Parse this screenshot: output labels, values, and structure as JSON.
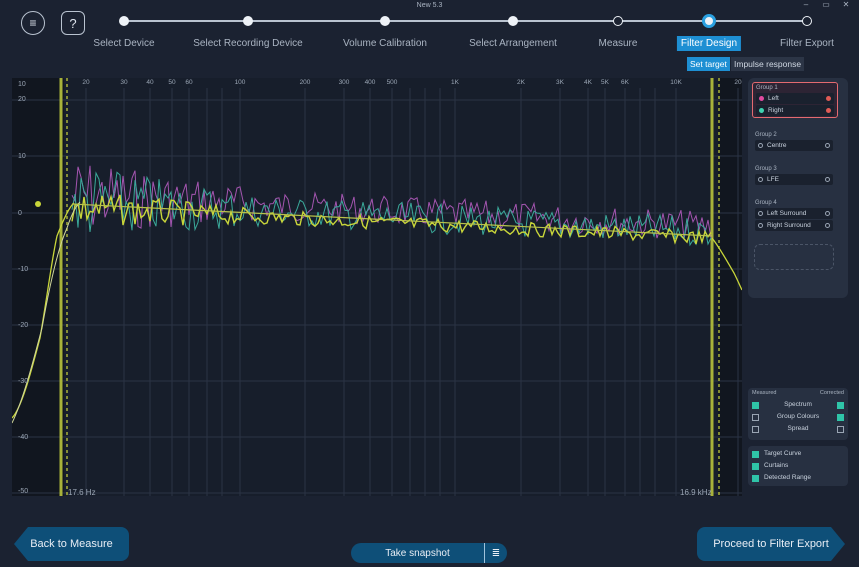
{
  "window": {
    "title": "New 5.3",
    "minimize": "–",
    "restore": "▭",
    "close": "✕"
  },
  "header": {
    "menu_icon": "≡",
    "help_icon": "?"
  },
  "steps": [
    {
      "label": "Select Device",
      "state": "done"
    },
    {
      "label": "Select Recording Device",
      "state": "done"
    },
    {
      "label": "Volume Calibration",
      "state": "done"
    },
    {
      "label": "Select Arrangement",
      "state": "done"
    },
    {
      "label": "Measure",
      "state": "open"
    },
    {
      "label": "Filter Design",
      "state": "active"
    },
    {
      "label": "Filter Export",
      "state": "open"
    }
  ],
  "subtabs": {
    "set_target": "Set target",
    "impulse_response": "Impulse response"
  },
  "graph": {
    "y_ticks": [
      "10",
      "20",
      "10",
      "0",
      "-10",
      "-20",
      "-30",
      "-40",
      "-50"
    ],
    "x_ticks": [
      "20",
      "30",
      "40",
      "50",
      "60",
      "100",
      "200",
      "300",
      "400",
      "500",
      "1K",
      "2K",
      "3K",
      "4K",
      "5K",
      "6K",
      "10K",
      "20"
    ],
    "low_edge": "17.6 Hz",
    "high_edge": "16.9 kHz",
    "colors": {
      "target": "#c9d63a",
      "left": "#a455b0",
      "right": "#3aa99a"
    }
  },
  "groups": [
    {
      "title": "Group 1",
      "channels": [
        {
          "name": "Left",
          "color": "#e04aa0"
        },
        {
          "name": "Right",
          "color": "#3fd3b0"
        }
      ]
    },
    {
      "title": "Group 2",
      "channels": [
        {
          "name": "Centre"
        }
      ]
    },
    {
      "title": "Group 3",
      "channels": [
        {
          "name": "LFE"
        }
      ]
    },
    {
      "title": "Group 4",
      "channels": [
        {
          "name": "Left Surround"
        },
        {
          "name": "Right Surround"
        }
      ]
    }
  ],
  "display_options": {
    "measured": "Measured",
    "corrected": "Corrected",
    "rows": [
      {
        "label": "Spectrum",
        "measured": true,
        "corrected": true
      },
      {
        "label": "Group Colours",
        "measured": false,
        "corrected": true
      },
      {
        "label": "Spread",
        "measured": false,
        "corrected": false
      }
    ]
  },
  "overlay_options": [
    {
      "label": "Target Curve",
      "checked": true
    },
    {
      "label": "Curtains",
      "checked": true
    },
    {
      "label": "Detected Range",
      "checked": true
    }
  ],
  "footer": {
    "back": "Back to Measure",
    "snapshot": "Take snapshot",
    "snapshot_icon": "≣",
    "proceed": "Proceed to Filter Export"
  }
}
